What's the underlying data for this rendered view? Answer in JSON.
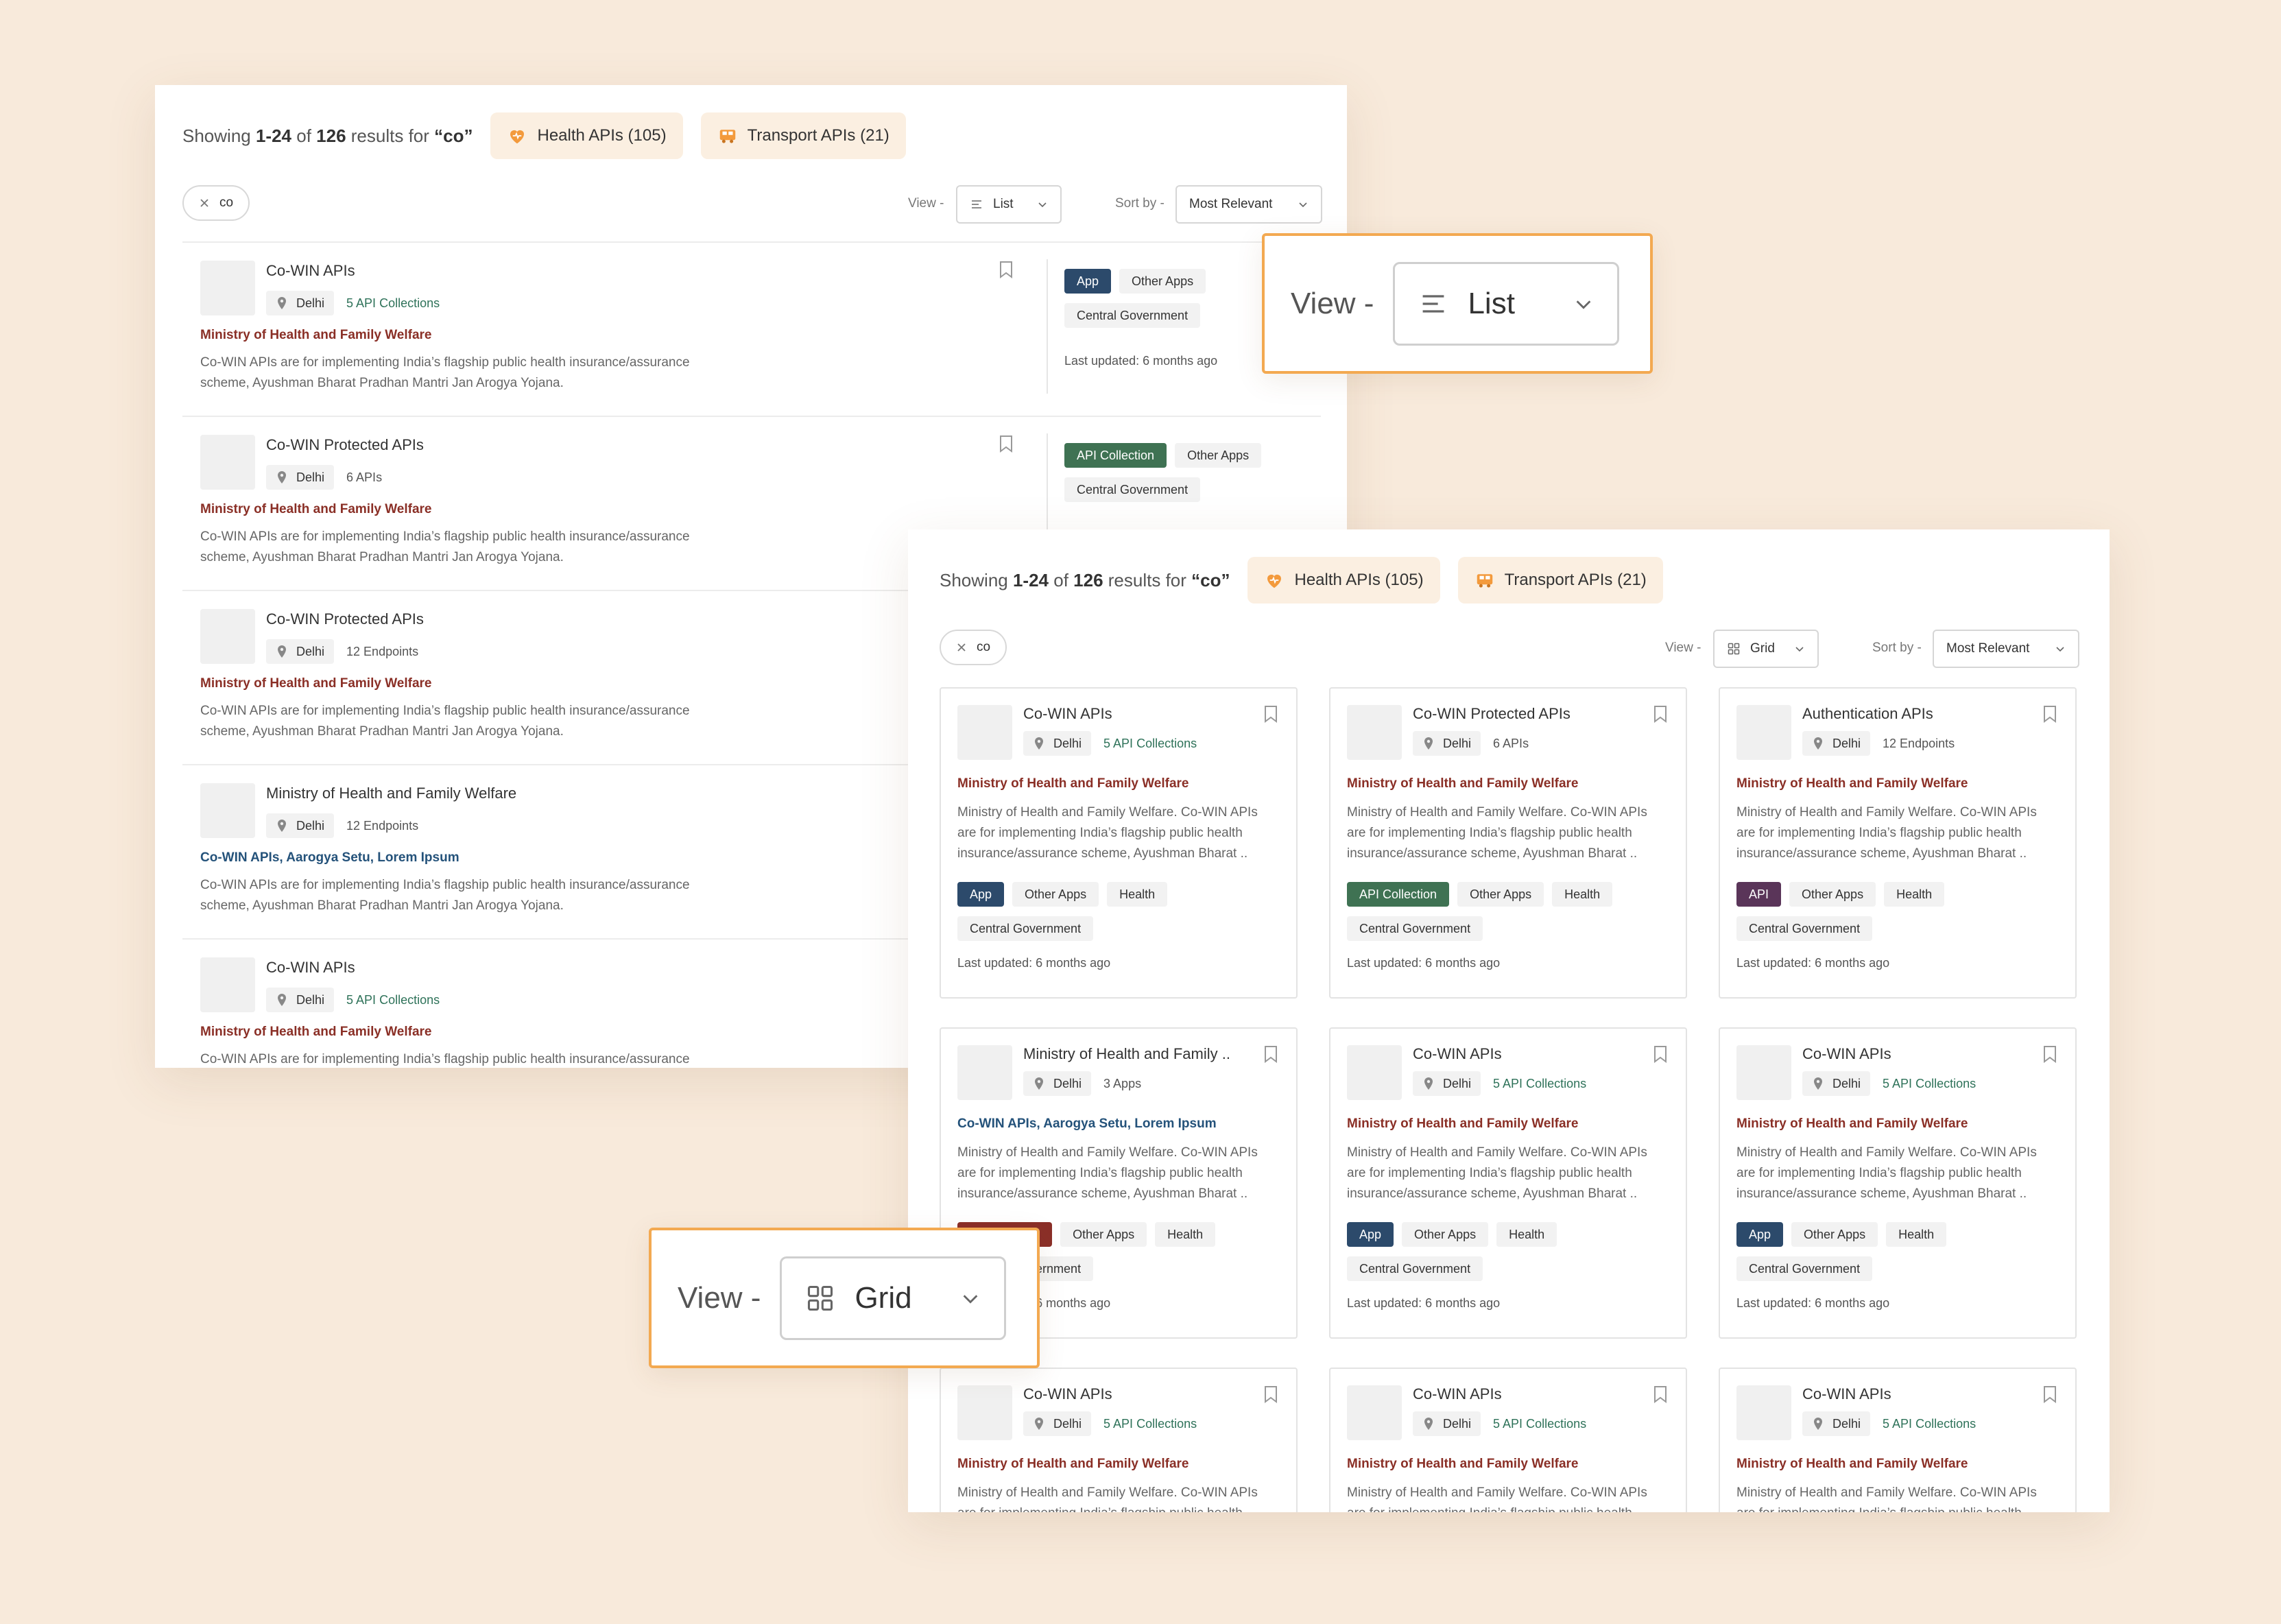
{
  "colors": {
    "background": "#f8eadb",
    "accent": "#f3a951",
    "ministry_red": "#8a2f26",
    "count_green": "#2e7259",
    "tag_app": "#2c4a6b",
    "tag_collection": "#3f7253",
    "tag_api": "#5a3559",
    "tag_org": "#8b2f28"
  },
  "list_view": {
    "results": {
      "prefix": "Showing ",
      "range": "1-24",
      "of": " of ",
      "total": "126",
      "middle": " results for ",
      "query": "“co”"
    },
    "filters": [
      {
        "icon": "heart-icon",
        "label": "Health APIs (105)"
      },
      {
        "icon": "bus-icon",
        "label": "Transport APIs (21)"
      }
    ],
    "search_chip": "co",
    "view_label": "View -",
    "view_value": "List",
    "view_icon": "list-icon",
    "sort_label": "Sort by -",
    "sort_value": "Most Relevant",
    "items": [
      {
        "title": "Co-WIN APIs",
        "location": "Delhi",
        "count": "5 API Collections",
        "subtitle": "Ministry of Health and Family Welfare",
        "desc1": "Co-WIN APIs are for implementing India’s flagship public health insurance/assurance",
        "desc2": "scheme, Ayushman Bharat Pradhan Mantri Jan Arogya Yojana.",
        "tag1": "App",
        "tag2": "Other Apps",
        "tag3": "Central Government",
        "updated": "Last updated: 6 months ago"
      },
      {
        "title": "Co-WIN Protected APIs",
        "location": "Delhi",
        "count": "6 APIs",
        "subtitle": "Ministry of Health and Family Welfare",
        "desc1": "Co-WIN APIs are for implementing India’s flagship public health insurance/assurance",
        "desc2": "scheme, Ayushman Bharat Pradhan Mantri Jan Arogya Yojana.",
        "tag1": "API Collection",
        "tag2": "Other Apps",
        "tag3": "Central Government"
      },
      {
        "title": "Co-WIN Protected APIs",
        "location": "Delhi",
        "count": "12 Endpoints",
        "subtitle": "Ministry of Health and Family Welfare",
        "desc1": "Co-WIN APIs are for implementing India’s flagship public health insurance/assurance",
        "desc2": "scheme, Ayushman Bharat Pradhan Mantri Jan Arogya Yojana."
      },
      {
        "title": "Ministry of Health and Family Welfare",
        "location": "Delhi",
        "count": "12 Endpoints",
        "subtitle": "Co-WIN APIs, Aarogya Setu, Lorem Ipsum",
        "desc1": "Co-WIN APIs are for implementing India’s flagship public health insurance/assurance",
        "desc2": "scheme, Ayushman Bharat Pradhan Mantri Jan Arogya Yojana."
      },
      {
        "title": "Co-WIN APIs",
        "location": "Delhi",
        "count": "5 API Collections",
        "subtitle": "Ministry of Health and Family Welfare",
        "desc1": "Co-WIN APIs are for implementing India’s flagship public health insurance/assurance"
      }
    ]
  },
  "grid_view": {
    "results": {
      "prefix": "Showing ",
      "range": "1-24",
      "of": " of ",
      "total": "126",
      "middle": " results for ",
      "query": "“co”"
    },
    "filters": [
      {
        "icon": "heart-icon",
        "label": "Health APIs (105)"
      },
      {
        "icon": "bus-icon",
        "label": "Transport APIs (21)"
      }
    ],
    "search_chip": "co",
    "view_label": "View -",
    "view_value": "Grid",
    "view_icon": "grid-icon",
    "sort_label": "Sort by -",
    "sort_value": "Most Relevant",
    "cards": [
      {
        "title": "Co-WIN APIs",
        "location": "Delhi",
        "count": "5 API Collections",
        "subtitle": "Ministry of Health and Family Welfare",
        "desc1": "Ministry of Health and Family Welfare. Co-WIN APIs",
        "desc2": "are for implementing India’s flagship public health",
        "desc3": "insurance/assurance scheme, Ayushman Bharat ..",
        "tag1": "App",
        "tag2": "Other Apps",
        "tag3": "Health",
        "tag4": "Central Government",
        "updated": "Last updated: 6 months ago"
      },
      {
        "title": "Co-WIN Protected APIs",
        "location": "Delhi",
        "count": "6 APIs",
        "subtitle": "Ministry of Health and Family Welfare",
        "desc1": "Ministry of Health and Family Welfare. Co-WIN APIs",
        "desc2": "are for implementing India’s flagship public health",
        "desc3": "insurance/assurance scheme, Ayushman Bharat ..",
        "tag1": "API Collection",
        "tag2": "Other Apps",
        "tag3": "Health",
        "tag4": "Central Government",
        "updated": "Last updated: 6 months ago"
      },
      {
        "title": "Authentication APIs",
        "location": "Delhi",
        "count": "12 Endpoints",
        "subtitle": "Ministry of Health and Family Welfare",
        "desc1": "Ministry of Health and Family Welfare. Co-WIN APIs",
        "desc2": "are for implementing India’s flagship public health",
        "desc3": "insurance/assurance scheme, Ayushman Bharat ..",
        "tag1": "API",
        "tag2": "Other Apps",
        "tag3": "Health",
        "tag4": "Central Government",
        "updated": "Last updated: 6 months ago"
      },
      {
        "title": "Ministry of Health and Family ..",
        "location": "Delhi",
        "count": "3 Apps",
        "subtitle": "Co-WIN APIs, Aarogya Setu, Lorem Ipsum",
        "desc1": "Ministry of Health and Family Welfare. Co-WIN APIs",
        "desc2": "are for implementing India’s flagship public health",
        "desc3": "insurance/assurance scheme, Ayushman Bharat ..",
        "tag1": "Organisation",
        "tag2": "Other Apps",
        "tag3": "Health",
        "tag4": "Central Government",
        "updated": "Last updated: 6 months ago"
      },
      {
        "title": "Co-WIN APIs",
        "location": "Delhi",
        "count": "5 API Collections",
        "subtitle": "Ministry of Health and Family Welfare",
        "desc1": "Ministry of Health and Family Welfare. Co-WIN APIs",
        "desc2": "are for implementing India’s flagship public health",
        "desc3": "insurance/assurance scheme, Ayushman Bharat ..",
        "tag1": "App",
        "tag2": "Other Apps",
        "tag3": "Health",
        "tag4": "Central Government",
        "updated": "Last updated: 6 months ago"
      },
      {
        "title": "Co-WIN APIs",
        "location": "Delhi",
        "count": "5 API Collections",
        "subtitle": "Ministry of Health and Family Welfare",
        "desc1": "Ministry of Health and Family Welfare. Co-WIN APIs",
        "desc2": "are for implementing India’s flagship public health",
        "desc3": "insurance/assurance scheme, Ayushman Bharat ..",
        "tag1": "App",
        "tag2": "Other Apps",
        "tag3": "Health",
        "tag4": "Central Government",
        "updated": "Last updated: 6 months ago"
      },
      {
        "title": "Co-WIN APIs",
        "location": "Delhi",
        "count": "5 API Collections",
        "subtitle": "Ministry of Health and Family Welfare",
        "desc1": "Ministry of Health and Family Welfare. Co-WIN APIs",
        "desc2": "are for implementing India’s flagship public health"
      },
      {
        "title": "Co-WIN APIs",
        "location": "Delhi",
        "count": "5 API Collections",
        "subtitle": "Ministry of Health and Family Welfare",
        "desc1": "Ministry of Health and Family Welfare. Co-WIN APIs",
        "desc2": "are for implementing India’s flagship public health"
      },
      {
        "title": "Co-WIN APIs",
        "location": "Delhi",
        "count": "5 API Collections",
        "subtitle": "Ministry of Health and Family Welfare",
        "desc1": "Ministry of Health and Family Welfare. Co-WIN APIs",
        "desc2": "are for implementing India’s flagship public health"
      }
    ]
  },
  "callouts": {
    "list": {
      "label": "View -",
      "value": "List",
      "icon": "list-icon"
    },
    "grid": {
      "label": "View -",
      "value": "Grid",
      "icon": "grid-icon"
    }
  }
}
